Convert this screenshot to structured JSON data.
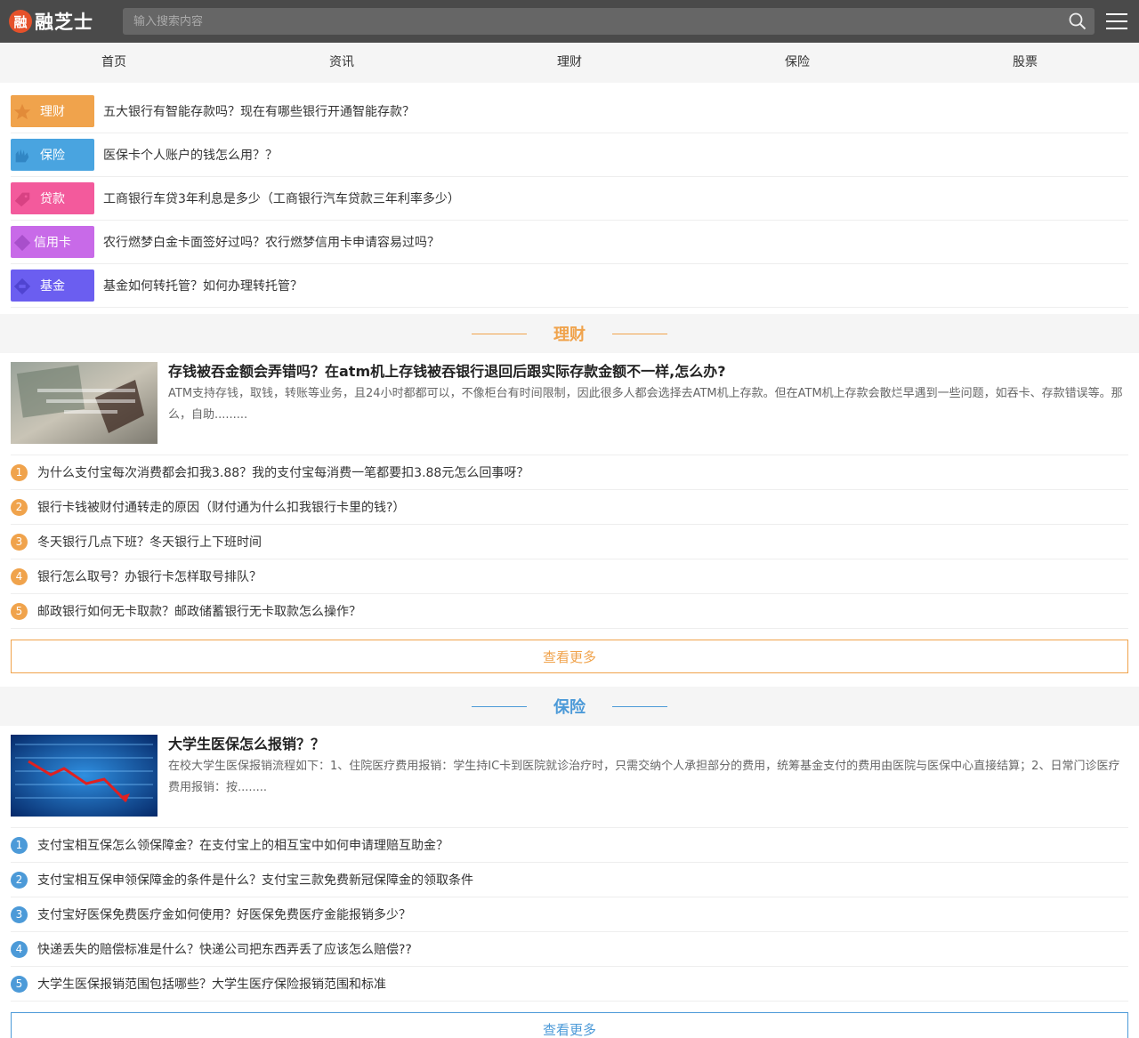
{
  "header": {
    "logo_char": "融",
    "logo_text": "融芝士",
    "search_placeholder": "输入搜索内容"
  },
  "nav": [
    "首页",
    "资讯",
    "理财",
    "保险",
    "股票"
  ],
  "categories": [
    {
      "label": "理财",
      "title": "五大银行有智能存款吗？现在有哪些银行开通智能存款？",
      "color": "#f0a34c",
      "icon": "star-icon"
    },
    {
      "label": "保险",
      "title": "医保卡个人账户的钱怎么用？？",
      "color": "#49a4e0",
      "icon": "hand-icon"
    },
    {
      "label": "贷款",
      "title": "工商银行车贷3年利息是多少（工商银行汽车贷款三年利率多少）",
      "color": "#f35a9c",
      "icon": "tag-icon"
    },
    {
      "label": "信用卡",
      "title": "农行燃梦白金卡面签好过吗？农行燃梦信用卡申请容易过吗？",
      "color": "#c86ae8",
      "icon": "diamond-icon"
    },
    {
      "label": "基金",
      "title": "基金如何转托管？如何办理转托管？",
      "color": "#6b5ef0",
      "icon": "card-icon"
    }
  ],
  "sections": [
    {
      "title": "理财",
      "color": "#f0a34c",
      "feature": {
        "title": "存钱被吞金额会弄错吗？在atm机上存钱被吞银行退回后跟实际存款金额不一样,怎么办?",
        "desc": "ATM支持存钱，取钱，转账等业务，且24小时都都可以，不像柜台有时间限制，因此很多人都会选择去ATM机上存款。但在ATM机上存款会散烂早遇到一些问题，如吞卡、存款错误等。那么，自助........."
      },
      "list": [
        "为什么支付宝每次消费都会扣我3.88？我的支付宝每消费一笔都要扣3.88元怎么回事呀？",
        "银行卡钱被财付通转走的原因（财付通为什么扣我银行卡里的钱?）",
        "冬天银行几点下班？冬天银行上下班时间",
        "银行怎么取号？办银行卡怎样取号排队？",
        "邮政银行如何无卡取款？邮政储蓄银行无卡取款怎么操作？"
      ],
      "more": "查看更多"
    },
    {
      "title": "保险",
      "color": "#4c9ad8",
      "feature": {
        "title": "大学生医保怎么报销？？",
        "desc": "在校大学生医保报销流程如下：1、住院医疗费用报销：学生持IC卡到医院就诊治疗时，只需交纳个人承担部分的费用，统筹基金支付的费用由医院与医保中心直接结算；2、日常门诊医疗费用报销：按........"
      },
      "list": [
        "支付宝相互保怎么领保障金？在支付宝上的相互宝中如何申请理赔互助金？",
        "支付宝相互保申领保障金的条件是什么？支付宝三款免费新冠保障金的领取条件",
        "支付宝好医保免费医疗金如何使用？好医保免费医疗金能报销多少？",
        "快递丢失的赔偿标准是什么？快递公司把东西弄丢了应该怎么赔偿??",
        "大学生医保报销范围包括哪些？大学生医疗保险报销范围和标准"
      ],
      "more": "查看更多"
    }
  ]
}
